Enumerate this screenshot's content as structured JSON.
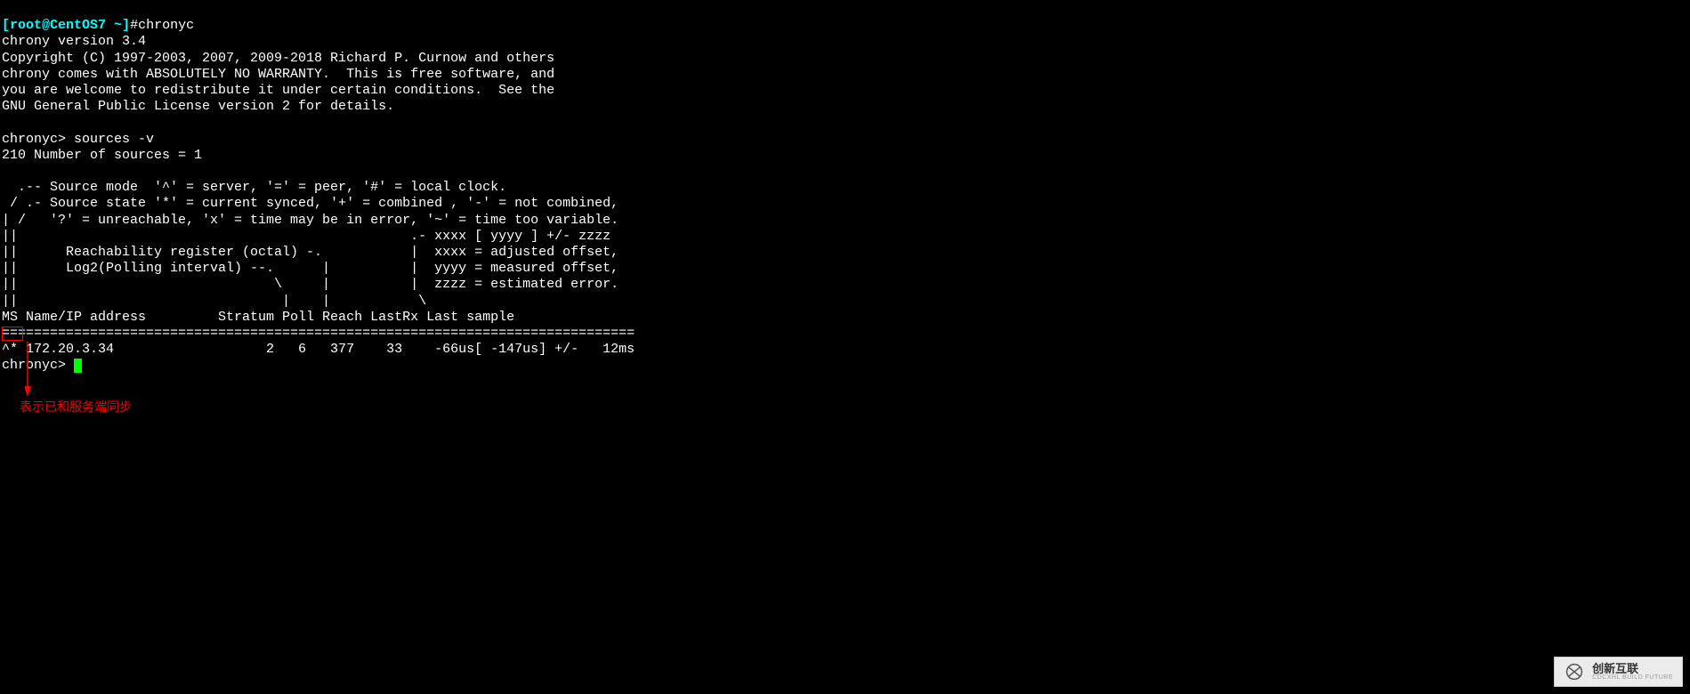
{
  "terminal": {
    "prompt": {
      "open_bracket": "[",
      "user_host": "root@CentOS7 ~",
      "close_bracket": "]",
      "hash": "#"
    },
    "command": "chronyc",
    "version_line": "chrony version 3.4",
    "copyright_line": "Copyright (C) 1997-2003, 2007, 2009-2018 Richard P. Curnow and others",
    "warranty_line": "chrony comes with ABSOLUTELY NO WARRANTY.  This is free software, and",
    "redistribute_line": "you are welcome to redistribute it under certain conditions.  See the",
    "gpl_line": "GNU General Public License version 2 for details.",
    "chronyc_prompt": "chronyc> ",
    "sources_cmd": "sources -v",
    "sources_count": "210 Number of sources = 1",
    "help_line1": "  .-- Source mode  '^' = server, '=' = peer, '#' = local clock.",
    "help_line2": " / .- Source state '*' = current synced, '+' = combined , '-' = not combined,",
    "help_line3": "| /   '?' = unreachable, 'x' = time may be in error, '~' = time too variable.",
    "help_line4": "||                                                 .- xxxx [ yyyy ] +/- zzzz",
    "help_line5": "||      Reachability register (octal) -.           |  xxxx = adjusted offset,",
    "help_line6": "||      Log2(Polling interval) --.      |          |  yyyy = measured offset,",
    "help_line7": "||                                \\     |          |  zzzz = estimated error.",
    "help_line8": "||                                 |    |           \\",
    "header_line": "MS Name/IP address         Stratum Poll Reach LastRx Last sample               ",
    "separator": "===============================================================================",
    "data_row": "^* 172.20.3.34                   2   6   377    33    -66us[ -147us] +/-   12ms",
    "end_prompt": "chronyc> "
  },
  "annotation": {
    "text": "表示已和服务端同步"
  },
  "watermark": {
    "main": "创新互联",
    "sub": "CDCXHL BUILD FUTURE"
  },
  "chart_data": {
    "type": "table",
    "title": "chronyc sources -v output",
    "columns": [
      "MS",
      "Name/IP address",
      "Stratum",
      "Poll",
      "Reach",
      "LastRx",
      "Last sample"
    ],
    "rows": [
      {
        "MS": "^*",
        "Name/IP address": "172.20.3.34",
        "Stratum": 2,
        "Poll": 6,
        "Reach": 377,
        "LastRx": 33,
        "Last sample": "-66us[ -147us] +/-   12ms"
      }
    ]
  }
}
